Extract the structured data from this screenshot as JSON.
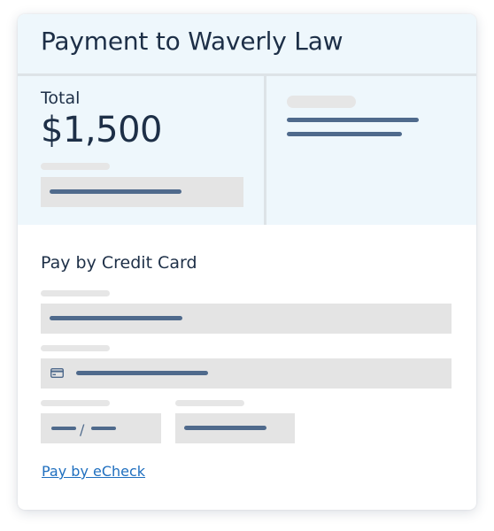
{
  "header": {
    "title": "Payment to Waverly Law"
  },
  "summary": {
    "total_label": "Total",
    "total_amount": "$1,500"
  },
  "credit_card_form": {
    "title": "Pay by Credit Card",
    "card_icon": "credit-card-icon",
    "expiry_separator": "/"
  },
  "echeck_link": "Pay by eCheck",
  "colors": {
    "header_bg": "#eef7fc",
    "text": "#1d2f47",
    "placeholder_line": "#4f6a8c",
    "placeholder_box": "#e4e4e4",
    "link": "#1f6fbf"
  }
}
